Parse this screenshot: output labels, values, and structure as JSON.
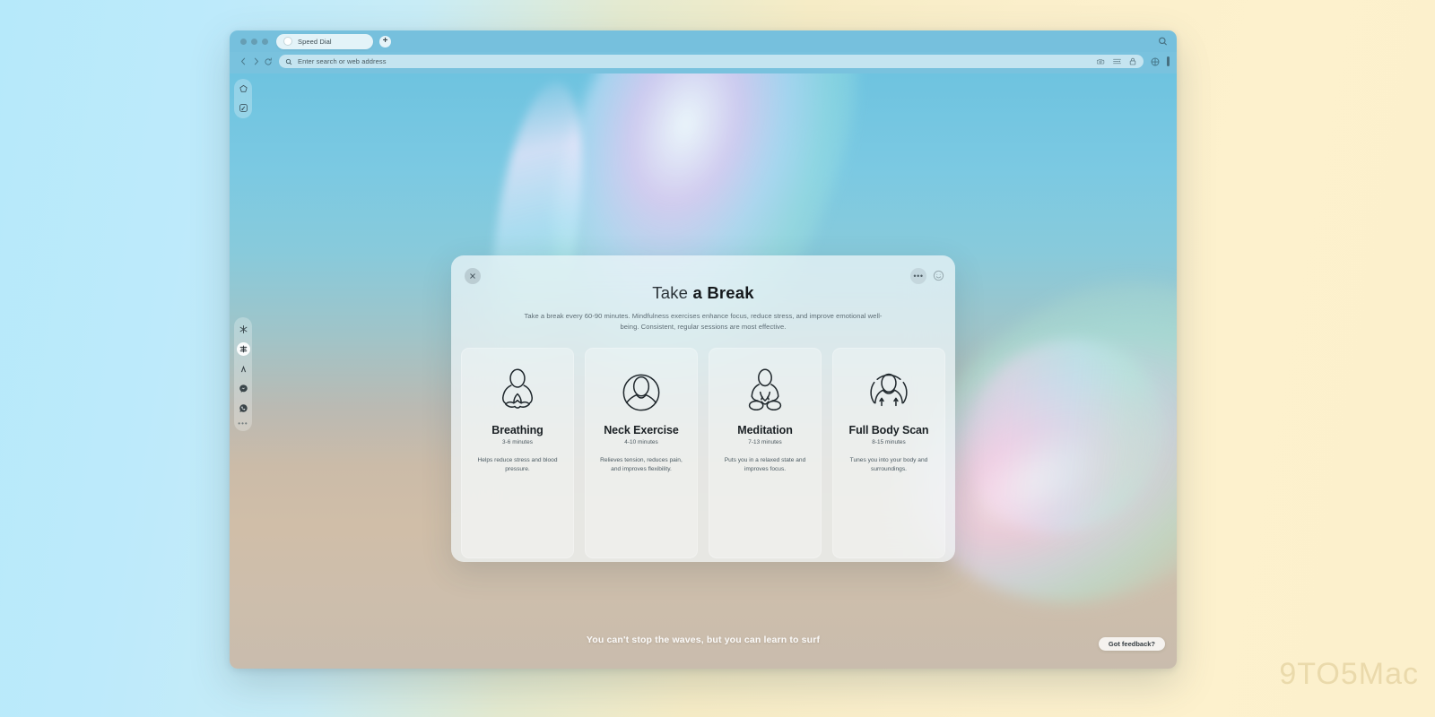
{
  "browser": {
    "tab": {
      "title": "Speed Dial",
      "favicon": "page-icon"
    },
    "new_tab_label": "+",
    "titlebar_search_icon": "search-icon",
    "nav": {
      "back_icon": "chevron-left-icon",
      "forward_icon": "chevron-right-icon",
      "reload_icon": "reload-icon",
      "search_icon": "search-icon",
      "address_placeholder": "Enter search or web address",
      "omnibox_icons": [
        "camera-icon",
        "reader-mode-icon",
        "lock-icon"
      ],
      "toolbar_icons": [
        "extensions-icon",
        "profile-bar-icon"
      ]
    }
  },
  "sidebar": {
    "top_items": [
      {
        "icon": "shield-pentagon-icon",
        "name": "browser-shield"
      },
      {
        "icon": "player-icon",
        "name": "media-player"
      }
    ],
    "mid_items": [
      {
        "icon": "snowflake-icon",
        "name": "pinboard"
      },
      {
        "icon": "speed-dial-icon",
        "name": "speed-dial",
        "active": true
      },
      {
        "icon": "person-icon",
        "name": "aria-assistant"
      },
      {
        "icon": "messenger-icon",
        "name": "messenger"
      },
      {
        "icon": "whatsapp-icon",
        "name": "whatsapp"
      }
    ],
    "more_label": "•••"
  },
  "modal": {
    "close_label": "✕",
    "more_label": "•••",
    "emoji_icon": "smiley-icon",
    "title_light": "Take",
    "title_bold": "a Break",
    "subtitle": "Take a break every 60-90 minutes. Mindfulness exercises enhance focus, reduce stress, and improve emotional well-being. Consistent, regular sessions are most effective.",
    "cards": [
      {
        "name": "Breathing",
        "duration": "3-6 minutes",
        "description": "Helps reduce stress and blood pressure.",
        "icon": "lotus-meditation-icon"
      },
      {
        "name": "Neck Exercise",
        "duration": "4-10 minutes",
        "description": "Relieves tension, reduces pain, and improves flexibility.",
        "icon": "neck-circle-icon"
      },
      {
        "name": "Meditation",
        "duration": "7-13 minutes",
        "description": "Puts you in a relaxed state and improves focus.",
        "icon": "seated-meditation-icon"
      },
      {
        "name": "Full Body Scan",
        "duration": "8-15 minutes",
        "description": "Tunes you into your body and surroundings.",
        "icon": "body-scan-icon"
      }
    ]
  },
  "footer": {
    "quote": "You can't stop the waves, but you can learn to surf",
    "feedback_label": "Got feedback?"
  },
  "watermark": "9TO5Mac",
  "colors": {
    "page_left": "#b6e9fa",
    "page_right": "#fcf0cc",
    "chrome": "#79c2de",
    "wallpaper_top": "#6ec3e0",
    "wallpaper_bottom": "#c9bcad",
    "modal_bg": "rgba(240,247,250,0.72)"
  }
}
